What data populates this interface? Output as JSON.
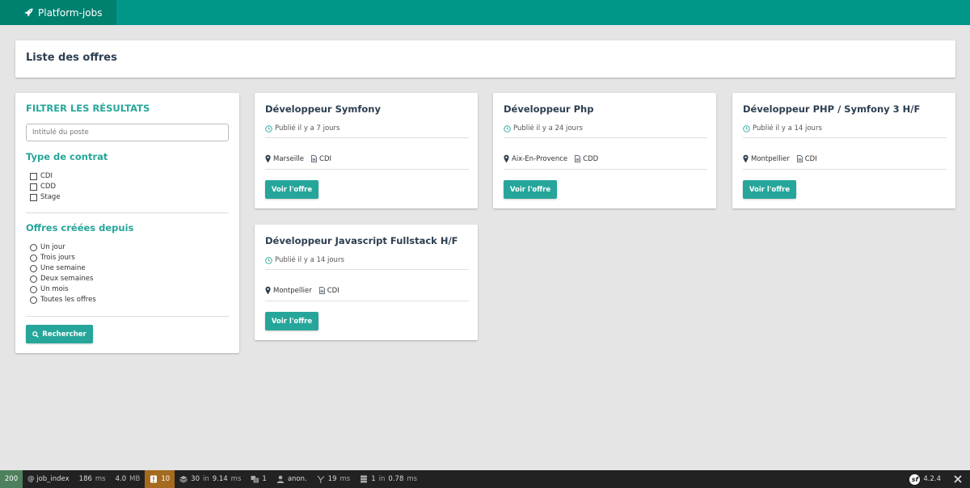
{
  "navbar": {
    "brand": "Platform-jobs"
  },
  "page": {
    "title": "Liste des offres"
  },
  "filters": {
    "heading": "FILTRER LES RÉSULTATS",
    "search_placeholder": "Intitulé du poste",
    "contract_heading": "Type de contrat",
    "contracts": [
      "CDI",
      "CDD",
      "Stage"
    ],
    "since_heading": "Offres créées depuis",
    "since_options": [
      "Un jour",
      "Trois jours",
      "Une semaine",
      "Deux semaines",
      "Un mois",
      "Toutes les offres"
    ],
    "search_button": "Rechercher"
  },
  "jobs": [
    {
      "title": "Développeur Symfony",
      "published": "Publié il y a 7 jours",
      "location": "Marseille",
      "contract": "CDI",
      "button": "Voir l'offre"
    },
    {
      "title": "Développeur Php",
      "published": "Publié il y a 24 jours",
      "location": "Aix-En-Provence",
      "contract": "CDD",
      "button": "Voir l'offre"
    },
    {
      "title": "Développeur PHP / Symfony 3 H/F",
      "published": "Publié il y a 14 jours",
      "location": "Montpellier",
      "contract": "CDI",
      "button": "Voir l'offre"
    },
    {
      "title": "Développeur Javascript Fullstack H/F",
      "published": "Publié il y a 14 jours",
      "location": "Montpellier",
      "contract": "CDI",
      "button": "Voir l'offre"
    }
  ],
  "debug": {
    "status": "200",
    "route": "@ job_index",
    "time_value": "186",
    "time_unit": "ms",
    "memory_value": "4.0",
    "memory_unit": "MB",
    "warnings": "10",
    "cache_value": "30",
    "cache_in": "in",
    "cache_time": "9.14",
    "cache_unit": "ms",
    "translations": "1",
    "user": "anon.",
    "twig_value": "19",
    "twig_unit": "ms",
    "db_value": "1",
    "db_in": "in",
    "db_time": "0.78",
    "db_unit": "ms",
    "version": "4.2.4"
  },
  "colors": {
    "primary": "#009688",
    "accent": "#26a69a",
    "debug_bg": "#222222"
  }
}
